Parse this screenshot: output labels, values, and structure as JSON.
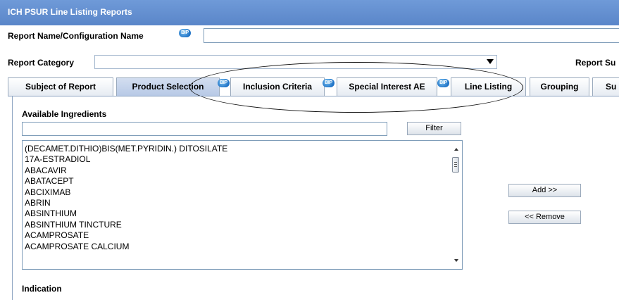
{
  "window": {
    "title": "ICH PSUR Line Listing Reports"
  },
  "form": {
    "report_name_label": "Report Name/Configuration Name",
    "report_name_value": "",
    "report_category_label": "Report Category",
    "report_category_value": "",
    "report_sub_label": "Report Su"
  },
  "badge": {
    "text": "BIP"
  },
  "tabs": [
    {
      "label": "Subject of Report",
      "active": false
    },
    {
      "label": "Product Selection",
      "active": true,
      "badge": true
    },
    {
      "label": "Inclusion Criteria",
      "active": false,
      "badge": true
    },
    {
      "label": "Special Interest AE",
      "active": false,
      "badge": true
    },
    {
      "label": "Line Listing",
      "active": false
    },
    {
      "label": "Grouping",
      "active": false
    },
    {
      "label": "Su",
      "active": false
    }
  ],
  "panel": {
    "available_label": "Available Ingredients",
    "filter_value": "",
    "filter_button": "Filter",
    "add_button": "Add >>",
    "remove_button": "<< Remove",
    "indication_label": "Indication",
    "ingredients": [
      "(DECAMET.DITHIO)BIS(MET.PYRIDIN.) DITOSILATE",
      "17A-ESTRADIOL",
      "ABACAVIR",
      "ABATACEPT",
      "ABCIXIMAB",
      "ABRIN",
      "ABSINTHIUM",
      "ABSINTHIUM TINCTURE",
      "ACAMPROSATE",
      "ACAMPROSATE CALCIUM"
    ]
  },
  "colors": {
    "titlebar": "#5a86c9",
    "tab_active": "#c5d4ec",
    "border": "#7f9db9"
  },
  "icons": {
    "bip_badge": "bip-badge-icon",
    "dropdown": "chevron-down-icon",
    "scroll_up": "scroll-up-arrow-icon",
    "scroll_down": "scroll-down-arrow-icon"
  }
}
